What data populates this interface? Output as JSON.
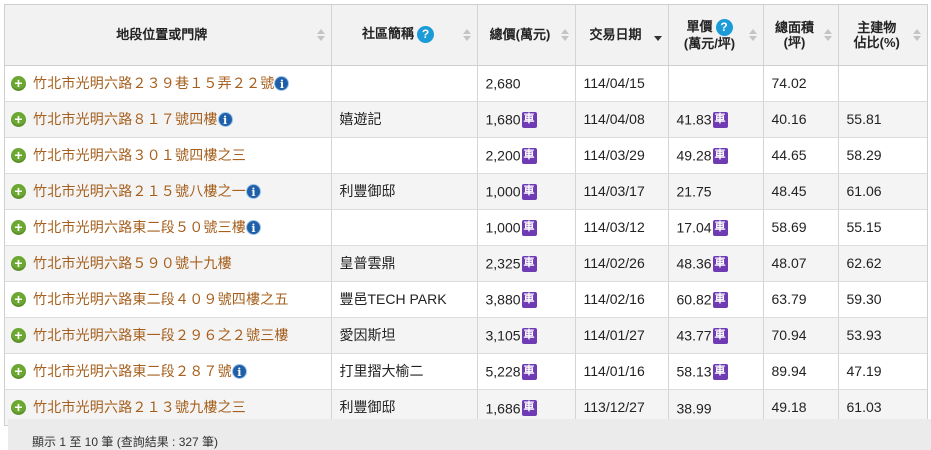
{
  "columns": {
    "address": "地段位置或門牌",
    "community": "社區簡稱",
    "total_price": "總價(萬元)",
    "date": "交易日期",
    "unit_price_line1": "單價",
    "unit_price_line2": "(萬元/坪)",
    "area_line1": "總面積",
    "area_line2": "(坪)",
    "ratio_line1": "主建物",
    "ratio_line2": "佔比(%)"
  },
  "icons": {
    "help": "?",
    "info": "i",
    "expand": "+",
    "parking": "車"
  },
  "rows": [
    {
      "address": "竹北市光明六路２３９巷１５弄２２號",
      "info": true,
      "community": "",
      "total": "2,680",
      "total_car": false,
      "date": "114/04/15",
      "unit": "",
      "unit_car": false,
      "area": "74.02",
      "ratio": ""
    },
    {
      "address": "竹北市光明六路８１７號四樓",
      "info": true,
      "community": "嬉遊記",
      "total": "1,680",
      "total_car": true,
      "date": "114/04/08",
      "unit": "41.83",
      "unit_car": true,
      "area": "40.16",
      "ratio": "55.81"
    },
    {
      "address": "竹北市光明六路３０１號四樓之三",
      "info": false,
      "community": "",
      "total": "2,200",
      "total_car": true,
      "date": "114/03/29",
      "unit": "49.28",
      "unit_car": true,
      "area": "44.65",
      "ratio": "58.29"
    },
    {
      "address": "竹北市光明六路２１５號八樓之一",
      "info": true,
      "community": "利豐御邸",
      "total": "1,000",
      "total_car": true,
      "date": "114/03/17",
      "unit": "21.75",
      "unit_car": false,
      "area": "48.45",
      "ratio": "61.06"
    },
    {
      "address": "竹北市光明六路東二段５０號三樓",
      "info": true,
      "community": "",
      "total": "1,000",
      "total_car": true,
      "date": "114/03/12",
      "unit": "17.04",
      "unit_car": true,
      "area": "58.69",
      "ratio": "55.15"
    },
    {
      "address": "竹北市光明六路５９０號十九樓",
      "info": false,
      "community": "皇普雲鼎",
      "total": "2,325",
      "total_car": true,
      "date": "114/02/26",
      "unit": "48.36",
      "unit_car": true,
      "area": "48.07",
      "ratio": "62.62"
    },
    {
      "address": "竹北市光明六路東二段４０９號四樓之五",
      "info": false,
      "community": "豐邑TECH PARK",
      "total": "3,880",
      "total_car": true,
      "date": "114/02/16",
      "unit": "60.82",
      "unit_car": true,
      "area": "63.79",
      "ratio": "59.30"
    },
    {
      "address": "竹北市光明六路東一段２９６之２號三樓",
      "info": false,
      "community": "愛因斯坦",
      "total": "3,105",
      "total_car": true,
      "date": "114/01/27",
      "unit": "43.77",
      "unit_car": true,
      "area": "70.94",
      "ratio": "53.93"
    },
    {
      "address": "竹北市光明六路東二段２８７號",
      "info": true,
      "community": "打里摺大榆二",
      "total": "5,228",
      "total_car": true,
      "date": "114/01/16",
      "unit": "58.13",
      "unit_car": true,
      "area": "89.94",
      "ratio": "47.19"
    },
    {
      "address": "竹北市光明六路２１３號九樓之三",
      "info": false,
      "community": "利豐御邸",
      "total": "1,686",
      "total_car": true,
      "date": "113/12/27",
      "unit": "38.99",
      "unit_car": false,
      "area": "49.18",
      "ratio": "61.03"
    }
  ],
  "footer": {
    "summary": "顯示 1 至 10 筆 (查詢結果 : 327 筆)"
  },
  "colors": {
    "address_link": "#a65f1c",
    "parking_badge": "#6e3bb3",
    "help_icon": "#1b9bd7",
    "expand_icon": "#6aa832"
  }
}
